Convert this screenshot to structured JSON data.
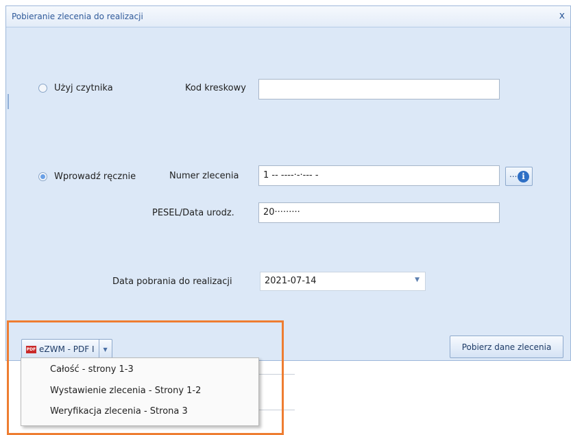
{
  "dialog": {
    "title": "Pobieranie zlecenia do realizacji",
    "close_glyph": "x"
  },
  "reader": {
    "radio_label": "Użyj czytnika",
    "barcode_label": "Kod kreskowy",
    "barcode_value": "",
    "selected": false
  },
  "manual": {
    "radio_label": "Wprowadź ręcznie",
    "selected": true,
    "order_number_label": "Numer zlecenia",
    "order_number_value": "1 -- ----·-·--- -",
    "pesel_label": "PESEL/Data urodz.",
    "pesel_value": "20·········",
    "dots_label": "...",
    "info_icon": "info-icon"
  },
  "date": {
    "label": "Data pobrania do realizacji",
    "value": "2021-07-14"
  },
  "pdf_button": {
    "label": "eZWM - PDF I",
    "icon": "pdf-icon",
    "icon_text": "PDF"
  },
  "fetch_button": {
    "label": "Pobierz dane zlecenia"
  },
  "pdf_menu": {
    "items": [
      "Całość - strony 1-3",
      "Wystawienie zlecenia - Strony 1-2",
      "Weryfikacja zlecenia - Strona 3"
    ]
  },
  "colors": {
    "dialog_bg": "#dce8f7",
    "highlight": "#ee7d31",
    "accent": "#2e6fc5"
  }
}
